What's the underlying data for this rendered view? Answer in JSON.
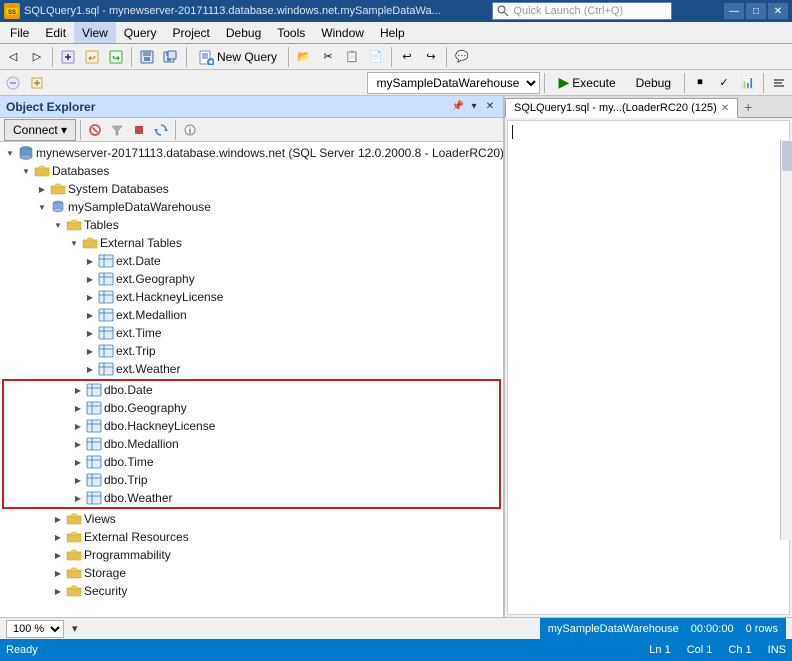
{
  "titlebar": {
    "icon_label": "SS",
    "title": "SQLQuery1.sql - mynewserver-20171113.database.windows.net.mySampleDataWa...",
    "quick_launch_placeholder": "Quick Launch (Ctrl+Q)",
    "minimize_label": "—",
    "maximize_label": "□",
    "close_label": "✕"
  },
  "menubar": {
    "items": [
      "File",
      "Edit",
      "View",
      "Query",
      "Project",
      "Debug",
      "Tools",
      "Window",
      "Help"
    ]
  },
  "toolbar1": {
    "new_query_label": "New Query",
    "toolbar_icons": [
      "◁",
      "▶",
      "⏹",
      "↩",
      "↪",
      "💾",
      "📋",
      "✂",
      "📄",
      "📋",
      "🔎"
    ]
  },
  "toolbar2": {
    "db_dropdown_value": "mySampleDataWarehouse",
    "execute_label": "Execute",
    "debug_label": "Debug"
  },
  "object_explorer": {
    "title": "Object Explorer",
    "connect_label": "Connect ▾",
    "tree": [
      {
        "id": "server",
        "level": 0,
        "label": "mynewserver-20171113.database.windows.net (SQL Server 12.0.2000.8 - LoaderRC20)",
        "expanded": true,
        "icon": "server",
        "expander": "▼"
      },
      {
        "id": "databases",
        "level": 1,
        "label": "Databases",
        "expanded": true,
        "icon": "folder",
        "expander": "▼"
      },
      {
        "id": "system-dbs",
        "level": 2,
        "label": "System Databases",
        "expanded": false,
        "icon": "folder",
        "expander": "▶"
      },
      {
        "id": "mySampleDW",
        "level": 2,
        "label": "mySampleDataWarehouse",
        "expanded": true,
        "icon": "db",
        "expander": "▼"
      },
      {
        "id": "tables",
        "level": 3,
        "label": "Tables",
        "expanded": true,
        "icon": "folder",
        "expander": "▼"
      },
      {
        "id": "ext-tables",
        "level": 4,
        "label": "External Tables",
        "expanded": true,
        "icon": "folder",
        "expander": "▼"
      },
      {
        "id": "ext-date",
        "level": 5,
        "label": "ext.Date",
        "expanded": false,
        "icon": "table",
        "expander": "▶"
      },
      {
        "id": "ext-geography",
        "level": 5,
        "label": "ext.Geography",
        "expanded": false,
        "icon": "table",
        "expander": "▶"
      },
      {
        "id": "ext-hackneylicense",
        "level": 5,
        "label": "ext.HackneyLicense",
        "expanded": false,
        "icon": "table",
        "expander": "▶"
      },
      {
        "id": "ext-medallion",
        "level": 5,
        "label": "ext.Medallion",
        "expanded": false,
        "icon": "table",
        "expander": "▶"
      },
      {
        "id": "ext-time",
        "level": 5,
        "label": "ext.Time",
        "expanded": false,
        "icon": "table",
        "expander": "▶"
      },
      {
        "id": "ext-trip",
        "level": 5,
        "label": "ext.Trip",
        "expanded": false,
        "icon": "table",
        "expander": "▶"
      },
      {
        "id": "ext-weather",
        "level": 5,
        "label": "ext.Weather",
        "expanded": false,
        "icon": "table",
        "expander": "▶"
      },
      {
        "id": "dbo-date",
        "level": 4,
        "label": "dbo.Date",
        "expanded": false,
        "icon": "table",
        "expander": "▶",
        "highlighted": true
      },
      {
        "id": "dbo-geography",
        "level": 4,
        "label": "dbo.Geography",
        "expanded": false,
        "icon": "table",
        "expander": "▶",
        "highlighted": true
      },
      {
        "id": "dbo-hackneylicense",
        "level": 4,
        "label": "dbo.HackneyLicense",
        "expanded": false,
        "icon": "table",
        "expander": "▶",
        "highlighted": true
      },
      {
        "id": "dbo-medallion",
        "level": 4,
        "label": "dbo.Medallion",
        "expanded": false,
        "icon": "table",
        "expander": "▶",
        "highlighted": true
      },
      {
        "id": "dbo-time",
        "level": 4,
        "label": "dbo.Time",
        "expanded": false,
        "icon": "table",
        "expander": "▶",
        "highlighted": true
      },
      {
        "id": "dbo-trip",
        "level": 4,
        "label": "dbo.Trip",
        "expanded": false,
        "icon": "table",
        "expander": "▶",
        "highlighted": true
      },
      {
        "id": "dbo-weather",
        "level": 4,
        "label": "dbo.Weather",
        "expanded": false,
        "icon": "table",
        "expander": "▶",
        "highlighted": true
      },
      {
        "id": "views",
        "level": 3,
        "label": "Views",
        "expanded": false,
        "icon": "folder",
        "expander": "▶"
      },
      {
        "id": "ext-resources",
        "level": 3,
        "label": "External Resources",
        "expanded": false,
        "icon": "folder",
        "expander": "▶"
      },
      {
        "id": "programmability",
        "level": 3,
        "label": "Programmability",
        "expanded": false,
        "icon": "folder",
        "expander": "▶"
      },
      {
        "id": "storage",
        "level": 3,
        "label": "Storage",
        "expanded": false,
        "icon": "folder",
        "expander": "▶"
      },
      {
        "id": "security",
        "level": 3,
        "label": "Security",
        "expanded": false,
        "icon": "folder",
        "expander": "▶"
      }
    ]
  },
  "query_panel": {
    "tab_label": "SQLQuery1.sql - my...(LoaderRC20 (125)",
    "close_label": "✕",
    "add_label": "+"
  },
  "status_bar": {
    "ready_label": "Ready",
    "ln_label": "Ln 1",
    "col_label": "Col 1",
    "ch_label": "Ch 1",
    "ins_label": "INS"
  },
  "bottom_bar": {
    "db_label": "mySampleDataWarehouse",
    "time_label": "00:00:00",
    "rows_label": "0 rows",
    "zoom_value": "100 %"
  }
}
